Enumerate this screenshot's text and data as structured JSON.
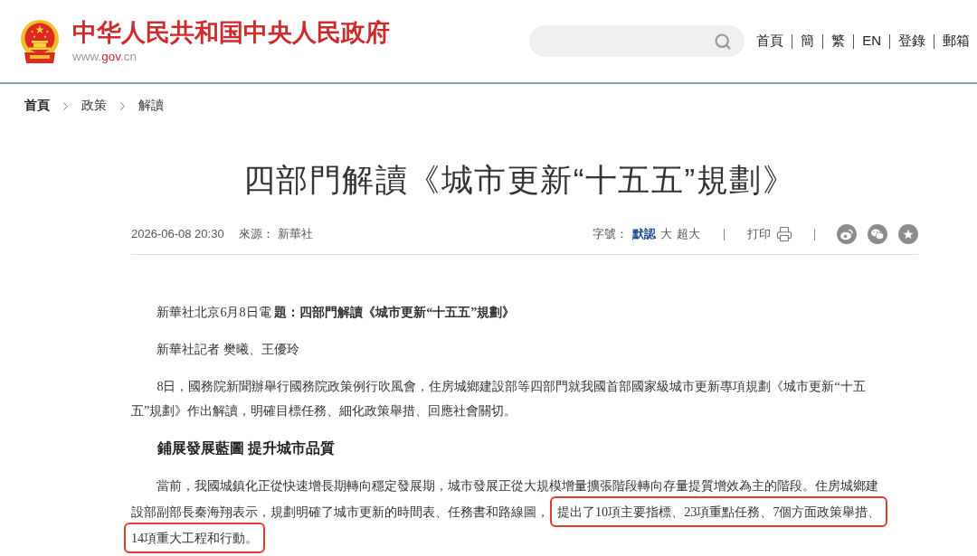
{
  "header": {
    "site_title": "中华人民共和国中央人民政府",
    "site_url": [
      {
        "text": "www.",
        "accent": false
      },
      {
        "text": "gov",
        "accent": true
      },
      {
        "text": ".cn",
        "accent": false
      }
    ],
    "nav": [
      "首頁",
      "簡",
      "繁",
      "EN",
      "登錄",
      "郵箱"
    ]
  },
  "breadcrumb": [
    "首頁",
    "政策",
    "解讀"
  ],
  "article": {
    "title": "四部門解讀《城市更新“十五五”規劃》",
    "meta": {
      "datetime": "2026-06-08 20:30",
      "source_label": "來源：",
      "source": "新華社",
      "font_size_label": "字號：",
      "font_sizes": [
        {
          "label": "默認",
          "selected": true
        },
        {
          "label": "大",
          "selected": false
        },
        {
          "label": "超大",
          "selected": false
        }
      ],
      "print_label": "打印"
    },
    "paragraphs": [
      {
        "kind": "dateline",
        "text": "新華社北京6月8日電 **題：四部門解讀《城市更新“十五五”規劃》**"
      },
      {
        "kind": "byline",
        "text": "新華社記者 樊曦、王優玲"
      },
      {
        "kind": "body",
        "lines": [
          [
            {
              "text": "8日，國務院新聞辦舉行國務院政策例行吹風會，住房城鄉建設部等四部門就我國首部國家級城市更新專項規劃《城市更新“十五",
              "highlighted": false
            }
          ],
          [
            {
              "text": "五”規劃》作出解讀，明確目標任務、細化政策舉措、回應社會關切。",
              "highlighted": false
            }
          ]
        ]
      },
      {
        "kind": "subheading",
        "text": "鋪展發展藍圖 提升城市品質"
      },
      {
        "kind": "body",
        "lines": [
          [
            {
              "text": "當前，我國城鎮化正從快速增長期轉向穩定發展期，城市發展正從大規模增量擴張階段轉向存量提質增效為主的階段。住房城鄉建",
              "highlighted": false
            }
          ],
          [
            {
              "text": "設部副部長秦海翔表示，規劃明確了城市更新的時間表、任務書和路線圖，",
              "highlighted": false
            },
            {
              "text": "提出了10項主要指標、23項重點任務、7個方面政策舉措、",
              "highlighted": true
            }
          ],
          [
            {
              "text": "14項重大工程和行動。",
              "highlighted": true
            }
          ]
        ]
      }
    ]
  }
}
